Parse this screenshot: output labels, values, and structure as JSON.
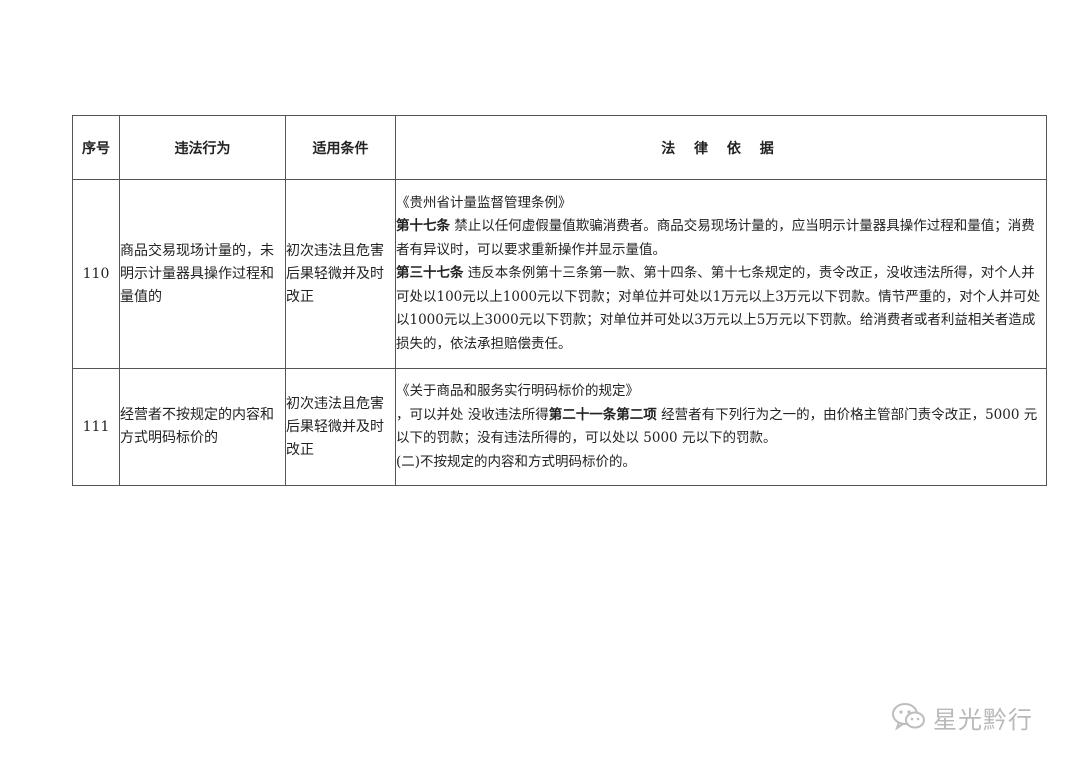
{
  "table": {
    "headers": [
      "序号",
      "违法行为",
      "适用条件",
      "法 律 依 据"
    ],
    "rows": [
      {
        "num": "110",
        "behavior": "商品交易现场计量的，未明示计量器具操作过程和量值的",
        "condition": "初次违法且危害后果轻微并及时改正",
        "basis": {
          "source": "《贵州省计量监督管理条例》",
          "a1_label": "第十七条",
          "a1_text": " 禁止以任何虚假量值欺骗消费者。商品交易现场计量的，应当明示计量器具操作过程和量值；消费者有异议时，可以要求重新操作并显示量值。",
          "a2_label": "第三十七条",
          "a2_text": " 违反本条例第十三条第一款、第十四条、第十七条规定的，责令改正，没收违法所得，对个人并可处以100元以上1000元以下罚款；对单位并可处以1万元以上3万元以下罚款。情节严重的，对个人并可处以1000元以上3000元以下罚款；对单位并可处以3万元以上5万元以下罚款。给消费者或者利益相关者造成损失的，依法承担赔偿责任。"
        }
      },
      {
        "num": "111",
        "behavior": "经营者不按规定的内容和方式明码标价的",
        "condition": "初次违法且危害后果轻微并及时改正",
        "basis": {
          "source": "《关于商品和服务实行明码标价的规定》",
          "l1_pre": "，可以并处 没收违法所得",
          "l1_label": "第二十一条第二项",
          "l1_post": " 经营者有下列行为之一的，由价格主管部门责令改正，5000 元以下的罚款；没有违法所得的，可以处以 5000 元以下的罚款。",
          "l2": "(二)不按规定的内容和方式明码标价的。"
        }
      }
    ]
  },
  "watermark": {
    "text": "星光黔行",
    "icon": "wechat-icon"
  }
}
